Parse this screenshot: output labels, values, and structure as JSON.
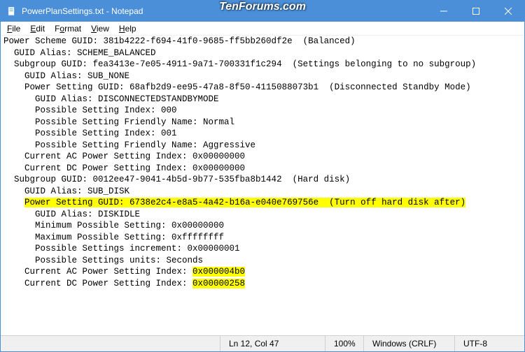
{
  "window": {
    "title": "PowerPlanSettings.txt - Notepad"
  },
  "watermark": "TenForums.com",
  "menu": {
    "file": "File",
    "edit": "Edit",
    "format": "Format",
    "view": "View",
    "help": "Help"
  },
  "content": {
    "lines": [
      {
        "t": "Power Scheme GUID: 381b4222-f694-41f0-9685-ff5bb260df2e  (Balanced)"
      },
      {
        "t": "  GUID Alias: SCHEME_BALANCED"
      },
      {
        "t": "  Subgroup GUID: fea3413e-7e05-4911-9a71-700331f1c294  (Settings belonging to no subgroup)"
      },
      {
        "t": "    GUID Alias: SUB_NONE"
      },
      {
        "t": "    Power Setting GUID: 68afb2d9-ee95-47a8-8f50-4115088073b1  (Disconnected Standby Mode)"
      },
      {
        "t": "      GUID Alias: DISCONNECTEDSTANDBYMODE"
      },
      {
        "t": "      Possible Setting Index: 000"
      },
      {
        "t": "      Possible Setting Friendly Name: Normal"
      },
      {
        "t": "      Possible Setting Index: 001"
      },
      {
        "t": "      Possible Setting Friendly Name: Aggressive"
      },
      {
        "t": "    Current AC Power Setting Index: 0x00000000"
      },
      {
        "t": "    Current DC Power Setting Index: 0x00000000"
      },
      {
        "t": ""
      },
      {
        "t": "  Subgroup GUID: 0012ee47-9041-4b5d-9b77-535fba8b1442  (Hard disk)"
      },
      {
        "t": "    GUID Alias: SUB_DISK"
      },
      {
        "pre": "    ",
        "hl": "Power Setting GUID: 6738e2c4-e8a5-4a42-b16a-e040e769756e  (Turn off hard disk after)"
      },
      {
        "t": "      GUID Alias: DISKIDLE"
      },
      {
        "t": "      Minimum Possible Setting: 0x00000000"
      },
      {
        "t": "      Maximum Possible Setting: 0xffffffff"
      },
      {
        "t": "      Possible Settings increment: 0x00000001"
      },
      {
        "t": "      Possible Settings units: Seconds"
      },
      {
        "pre": "    Current AC Power Setting Index: ",
        "hl": "0x000004b0"
      },
      {
        "pre": "    Current DC Power Setting Index: ",
        "hl": "0x00000258"
      }
    ]
  },
  "status": {
    "position": "Ln 12, Col 47",
    "zoom": "100%",
    "eol": "Windows (CRLF)",
    "encoding": "UTF-8"
  }
}
